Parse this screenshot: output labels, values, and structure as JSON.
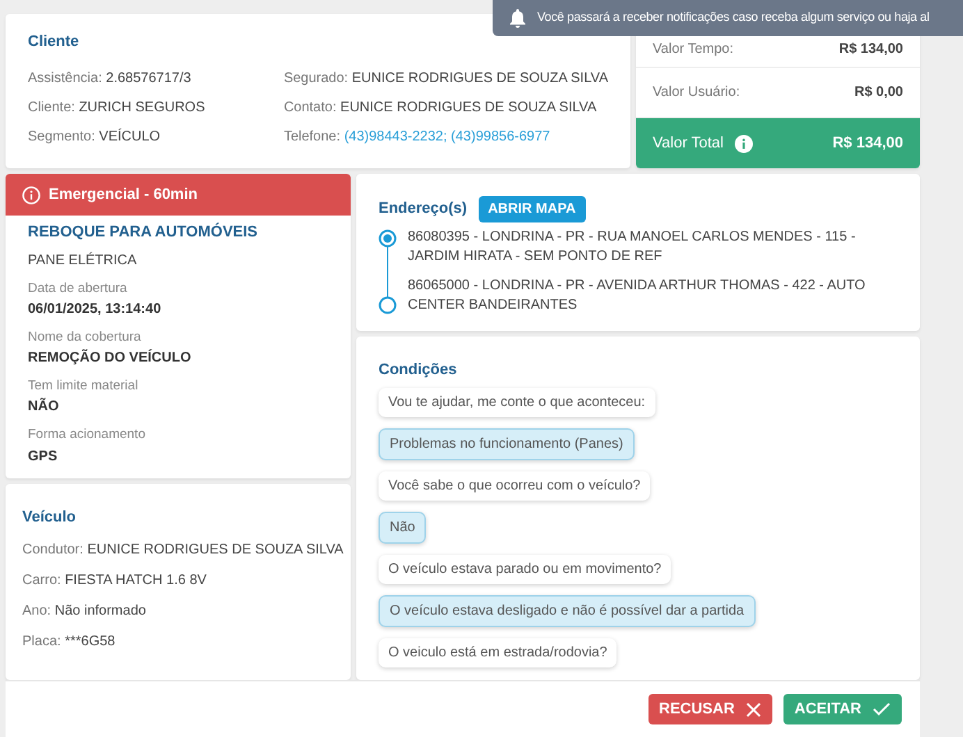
{
  "toast": {
    "text": "Você passará a receber notificações caso receba algum serviço ou haja al"
  },
  "client": {
    "title": "Cliente",
    "left": [
      {
        "label": "Assistência:",
        "value": "2.68576717/3"
      },
      {
        "label": "Cliente:",
        "value": "ZURICH SEGUROS"
      },
      {
        "label": "Segmento:",
        "value": "VEÍCULO"
      }
    ],
    "right": [
      {
        "label": "Segurado:",
        "value": "EUNICE RODRIGUES DE SOUZA SILVA",
        "kind": "text"
      },
      {
        "label": "Contato:",
        "value": "EUNICE RODRIGUES DE SOUZA SILVA",
        "kind": "text"
      },
      {
        "label": "Telefone:",
        "value": "(43)98443-2232; (43)99856-6977",
        "kind": "link"
      }
    ]
  },
  "values": {
    "rows": [
      {
        "label": "Valor Tempo:",
        "value": "R$ 134,00"
      },
      {
        "label": "Valor Usuário:",
        "value": "R$ 0,00"
      }
    ],
    "total": {
      "label": "Valor Total",
      "value": "R$ 134,00"
    }
  },
  "service": {
    "alert": "Emergencial - 60min",
    "title": "REBOQUE PARA AUTOMÓVEIS",
    "subtitle": "PANE ELÉTRICA",
    "fields": [
      {
        "label": "Data de abertura",
        "value": "06/01/2025, 13:14:40"
      },
      {
        "label": "Nome da cobertura",
        "value": "REMOÇÃO DO VEÍCULO"
      },
      {
        "label": "Tem limite material",
        "value": "NÃO"
      },
      {
        "label": "Forma acionamento",
        "value": "GPS"
      }
    ]
  },
  "vehicle": {
    "title": "Veículo",
    "fields": [
      {
        "label": "Condutor:",
        "value": "EUNICE RODRIGUES DE SOUZA SILVA"
      },
      {
        "label": "Carro:",
        "value": "FIESTA HATCH 1.6 8V"
      },
      {
        "label": "Ano:",
        "value": "Não informado"
      },
      {
        "label": "Placa:",
        "value": "***6G58"
      }
    ]
  },
  "addresses": {
    "title": "Endereço(s)",
    "map_button": "ABRIR MAPA",
    "items": [
      {
        "text": "86080395 - LONDRINA - PR - RUA MANOEL CARLOS MENDES - 115 - JARDIM HIRATA - SEM PONTO DE REF",
        "kind": "origin"
      },
      {
        "text": "86065000 - LONDRINA - PR - AVENIDA ARTHUR THOMAS - 422 - AUTO CENTER BANDEIRANTES",
        "kind": "destination"
      }
    ]
  },
  "conditions": {
    "title": "Condições",
    "messages": [
      {
        "text": "Vou te ajudar, me conte o que aconteceu:",
        "kind": "question"
      },
      {
        "text": "Problemas no funcionamento (Panes)",
        "kind": "answer"
      },
      {
        "text": "Você sabe o que ocorreu com o veículo?",
        "kind": "question"
      },
      {
        "text": "Não",
        "kind": "answer"
      },
      {
        "text": "O veículo estava parado ou em movimento?",
        "kind": "question"
      },
      {
        "text": "O veículo estava desligado e não é possível dar a partida",
        "kind": "answer"
      },
      {
        "text": "O veiculo está em estrada/rodovia?",
        "kind": "question"
      }
    ]
  },
  "buttons": [
    {
      "label": "RECUSAR",
      "kind": "refuse"
    },
    {
      "label": "ACEITAR",
      "kind": "accept"
    }
  ]
}
